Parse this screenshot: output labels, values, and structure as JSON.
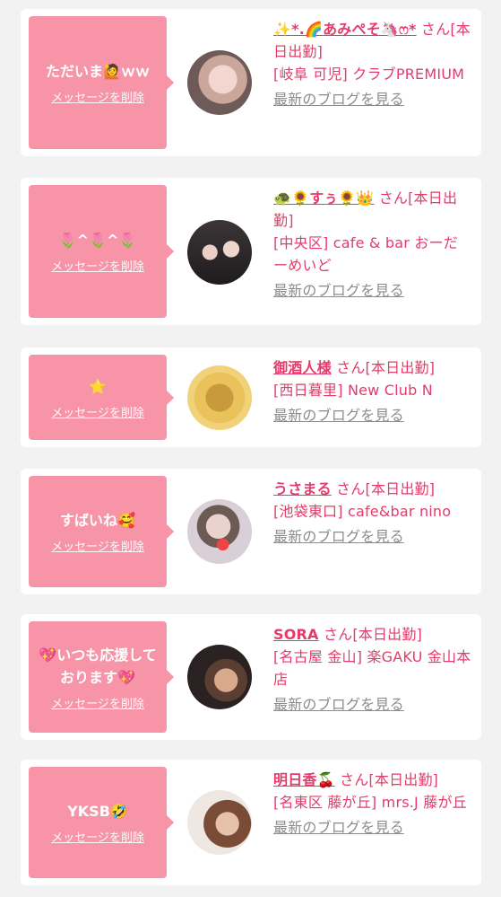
{
  "entries": [
    {
      "message": "ただいま🙋ｗｗ",
      "delete_label": "メッセージを削除",
      "name": "✨*.🌈あみぺそ🦄ෆ*",
      "suffix": "さん[本日出勤]",
      "shop": "[岐阜 可児] クラブPREMIUM",
      "blog_label": "最新のブログを見る"
    },
    {
      "message": "🌷^🌷^🌷",
      "delete_label": "メッセージを削除",
      "name": "🐢🌻すぅ🌻👑",
      "suffix": "さん[本日出勤]",
      "shop": "[中央区] cafe & bar おーだーめいど",
      "blog_label": "最新のブログを見る"
    },
    {
      "message": "⭐",
      "delete_label": "メッセージを削除",
      "name": "御酒人様",
      "suffix": "さん[本日出勤]",
      "shop": "[西日暮里] New Club N",
      "blog_label": "最新のブログを見る"
    },
    {
      "message": "すばいね🥰",
      "delete_label": "メッセージを削除",
      "name": "うさまる",
      "suffix": "さん[本日出勤]",
      "shop": "[池袋東口] cafe&bar nino",
      "blog_label": "最新のブログを見る"
    },
    {
      "message": "💖いつも応援しております💖",
      "delete_label": "メッセージを削除",
      "name": "SORA",
      "suffix": "さん[本日出勤]",
      "shop": "[名古屋 金山] 楽GAKU 金山本店",
      "blog_label": "最新のブログを見る"
    },
    {
      "message": "YKSB🤣",
      "delete_label": "メッセージを削除",
      "name": "明日香🍒",
      "suffix": "さん[本日出勤]",
      "shop": "[名東区 藤が丘] mrs.J 藤が丘",
      "blog_label": "最新のブログを見る"
    }
  ]
}
